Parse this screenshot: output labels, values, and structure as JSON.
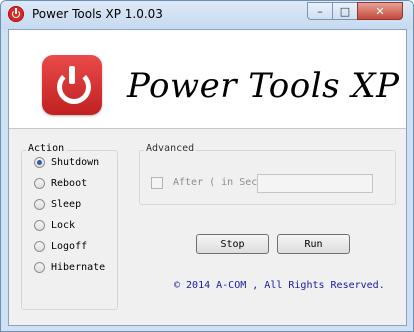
{
  "window": {
    "title": "Power Tools XP 1.0.03",
    "close_glyph": "✕",
    "minimize_glyph": "–",
    "maximize_glyph": "□"
  },
  "banner": {
    "app_name": "Power Tools XP",
    "logo_icon": "power-icon"
  },
  "action": {
    "legend": "Action",
    "options": [
      {
        "label": "Shutdown",
        "selected": true
      },
      {
        "label": "Reboot",
        "selected": false
      },
      {
        "label": "Sleep",
        "selected": false
      },
      {
        "label": "Lock",
        "selected": false
      },
      {
        "label": "Logoff",
        "selected": false
      },
      {
        "label": "Hibernate",
        "selected": false
      }
    ]
  },
  "advanced": {
    "legend": "Advanced",
    "after_label": "After ( in Sec ) :",
    "seconds_value": "",
    "checked": false,
    "enabled": false
  },
  "buttons": {
    "stop": "Stop",
    "run": "Run"
  },
  "footer": {
    "copyright": "© 2014 A-COM , All Rights Reserved."
  },
  "colors": {
    "accent_red": "#d42a2a",
    "copyright_blue": "#1a1aa0"
  }
}
